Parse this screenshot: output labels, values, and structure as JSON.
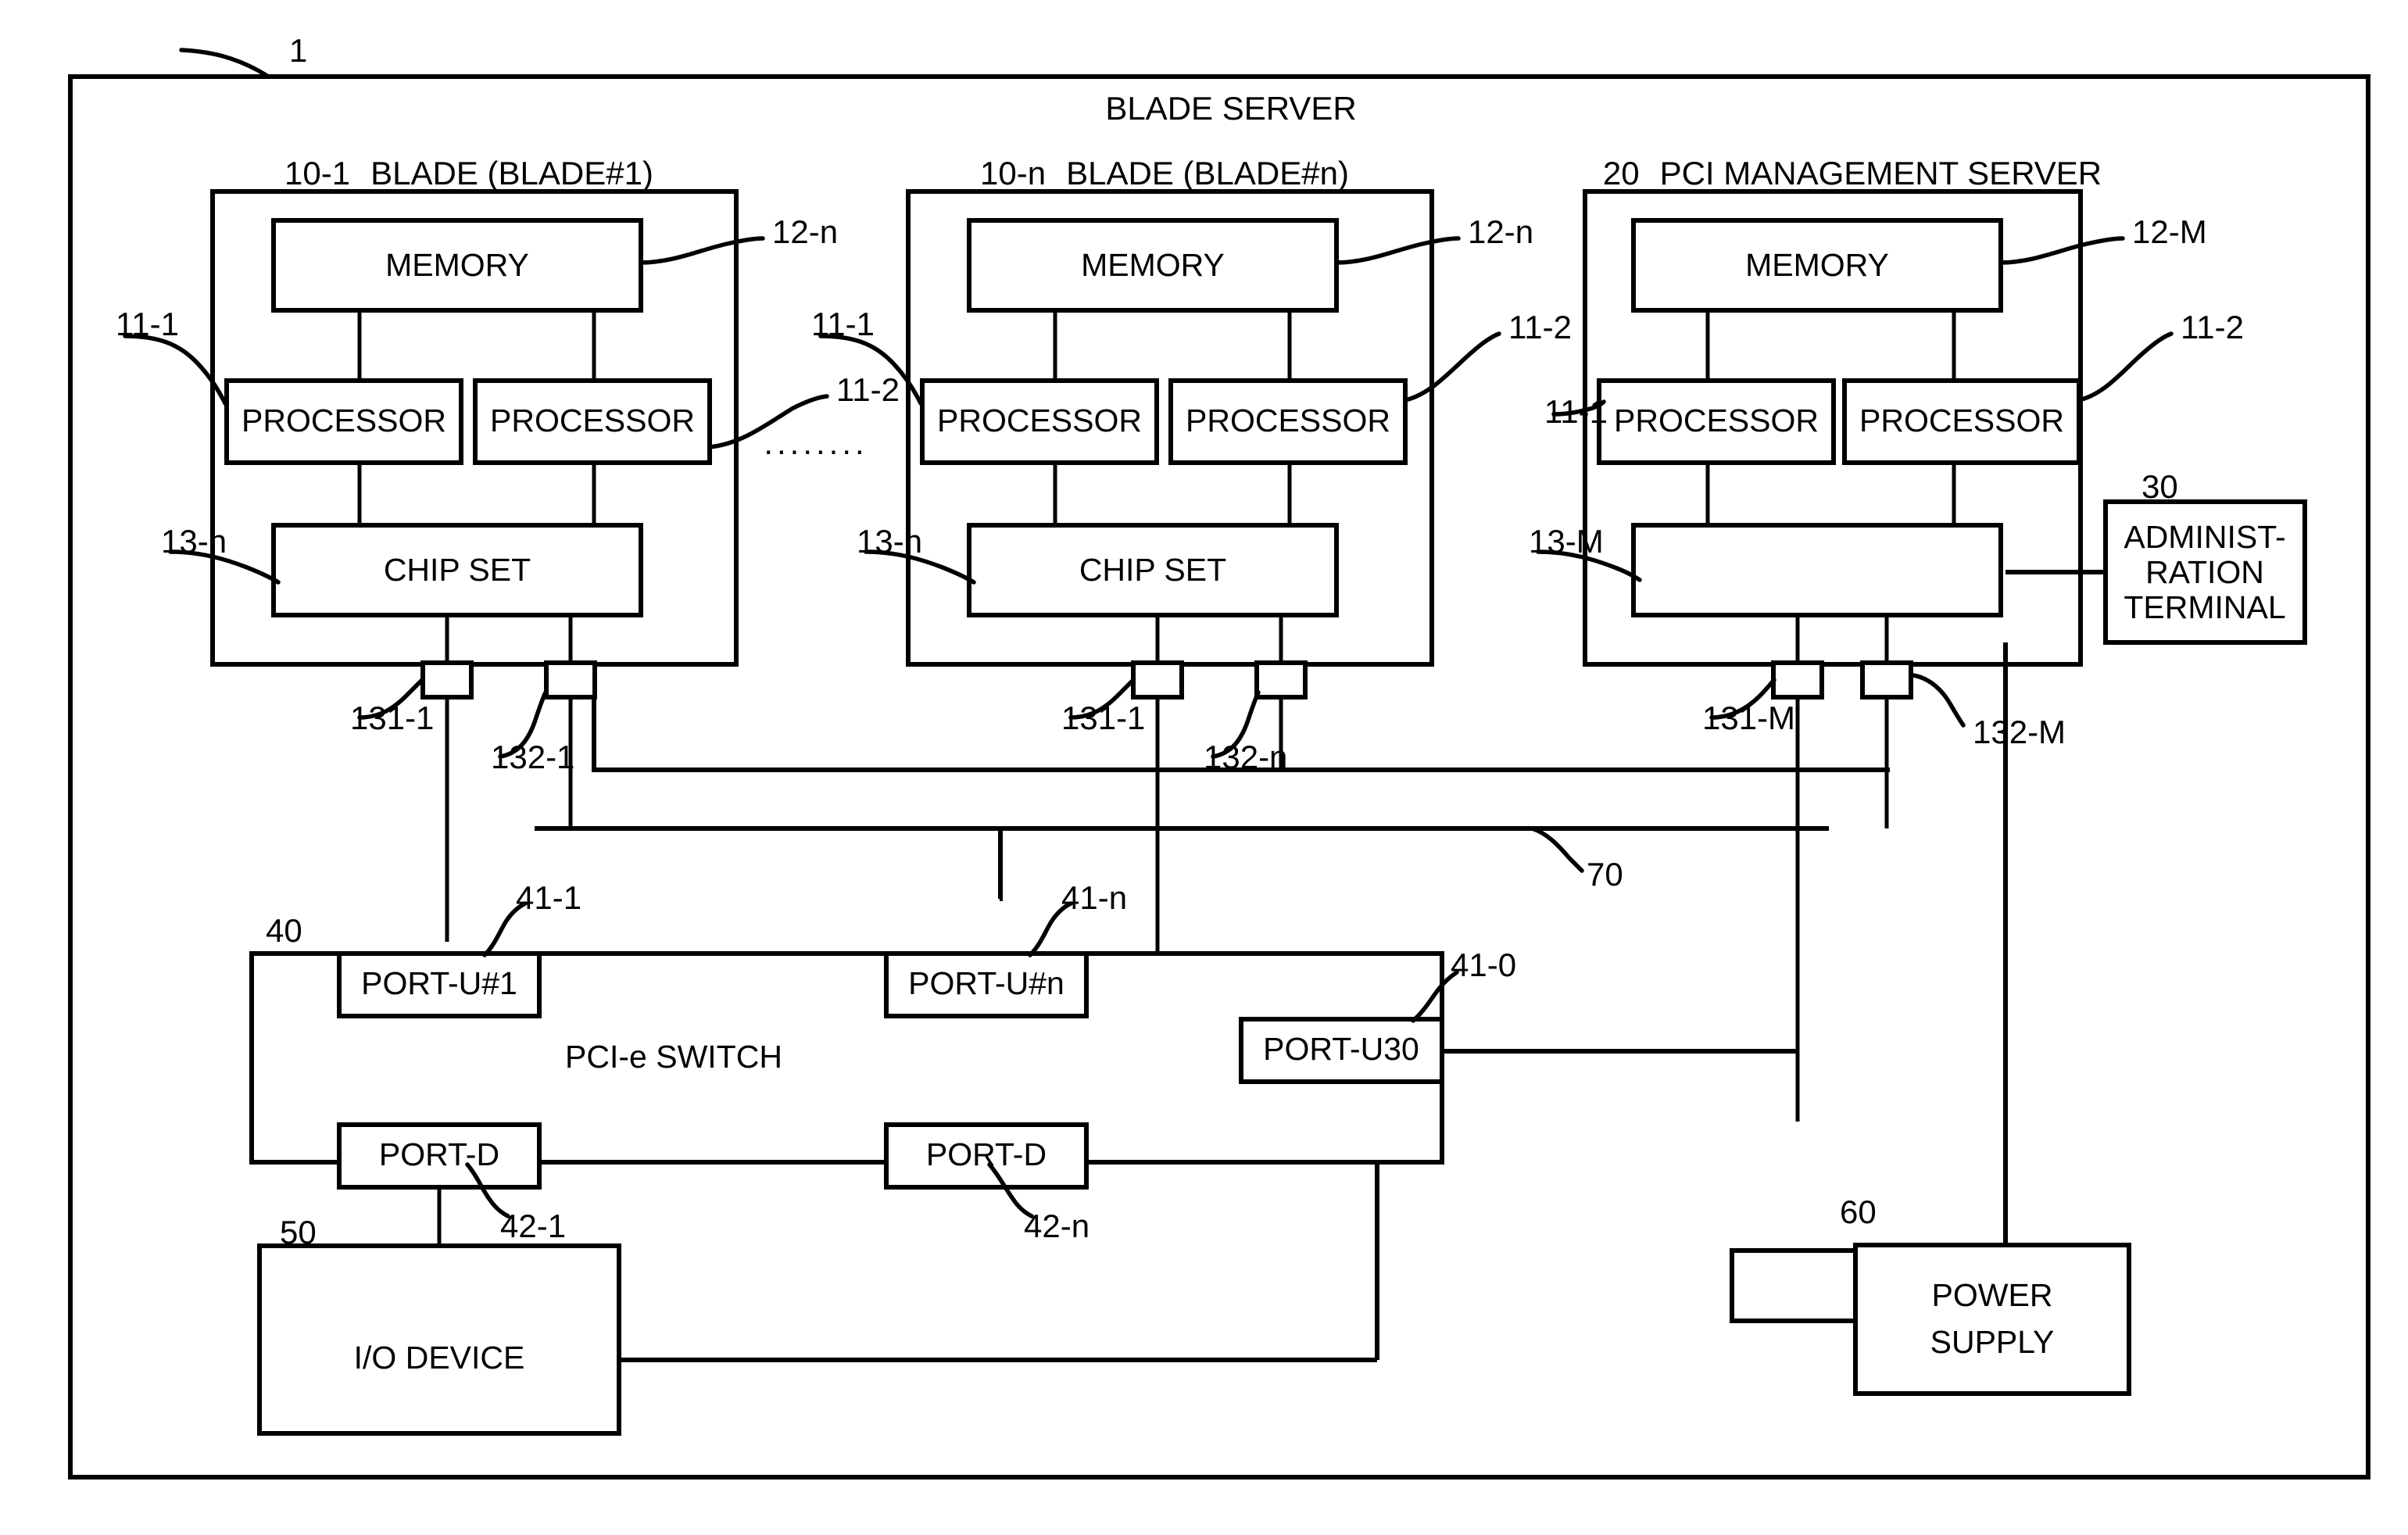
{
  "figure": {
    "figure_ref": "1",
    "outer_title": "BLADE SERVER"
  },
  "blades": [
    {
      "ref": "10-1",
      "title": "BLADE (BLADE#1)",
      "memory_label": "MEMORY",
      "memory_ref": "12-n",
      "processor1_label": "PROCESSOR",
      "processor1_ref": "11-1",
      "processor2_label": "PROCESSOR",
      "processor2_ref": "11-2",
      "chipset_label": "CHIP SET",
      "chipset_ref": "13-n",
      "port1_ref": "131-1",
      "port2_ref": "132-1"
    },
    {
      "ref": "10-n",
      "title": "BLADE (BLADE#n)",
      "memory_label": "MEMORY",
      "memory_ref": "12-n",
      "processor1_label": "PROCESSOR",
      "processor1_ref": "11-1",
      "processor2_label": "PROCESSOR",
      "processor2_ref": "11-2",
      "chipset_label": "CHIP SET",
      "chipset_ref": "13-n",
      "port1_ref": "131-1",
      "port2_ref": "132-n"
    }
  ],
  "ellipsis": "........",
  "management_server": {
    "ref": "20",
    "title": "PCI MANAGEMENT SERVER",
    "memory_label": "MEMORY",
    "memory_ref": "12-M",
    "processor1_label": "PROCESSOR",
    "processor1_ref": "11-1",
    "processor2_label": "PROCESSOR",
    "processor2_ref": "11-2",
    "chipset_label": "",
    "chipset_ref": "13-M",
    "port1_ref": "131-M",
    "port2_ref": "132-M"
  },
  "admin_terminal": {
    "ref": "30",
    "line1": "ADMINIST-",
    "line2": "RATION",
    "line3": "TERMINAL"
  },
  "bus": {
    "ref": "70"
  },
  "switch": {
    "ref": "40",
    "label": "PCI-e SWITCH",
    "ports": [
      {
        "label": "PORT-U#1",
        "ref": "41-1"
      },
      {
        "label": "PORT-U#n",
        "ref": "41-n"
      },
      {
        "label": "PORT-U30",
        "ref": "41-0"
      },
      {
        "label": "PORT-D",
        "ref": "42-1"
      },
      {
        "label": "PORT-D",
        "ref": "42-n"
      }
    ]
  },
  "io_device": {
    "ref": "50",
    "label": "I/O DEVICE"
  },
  "power_supply": {
    "ref": "60",
    "line1": "POWER",
    "line2": "SUPPLY"
  },
  "colors": {
    "stroke": "#000000",
    "background": "#ffffff"
  }
}
